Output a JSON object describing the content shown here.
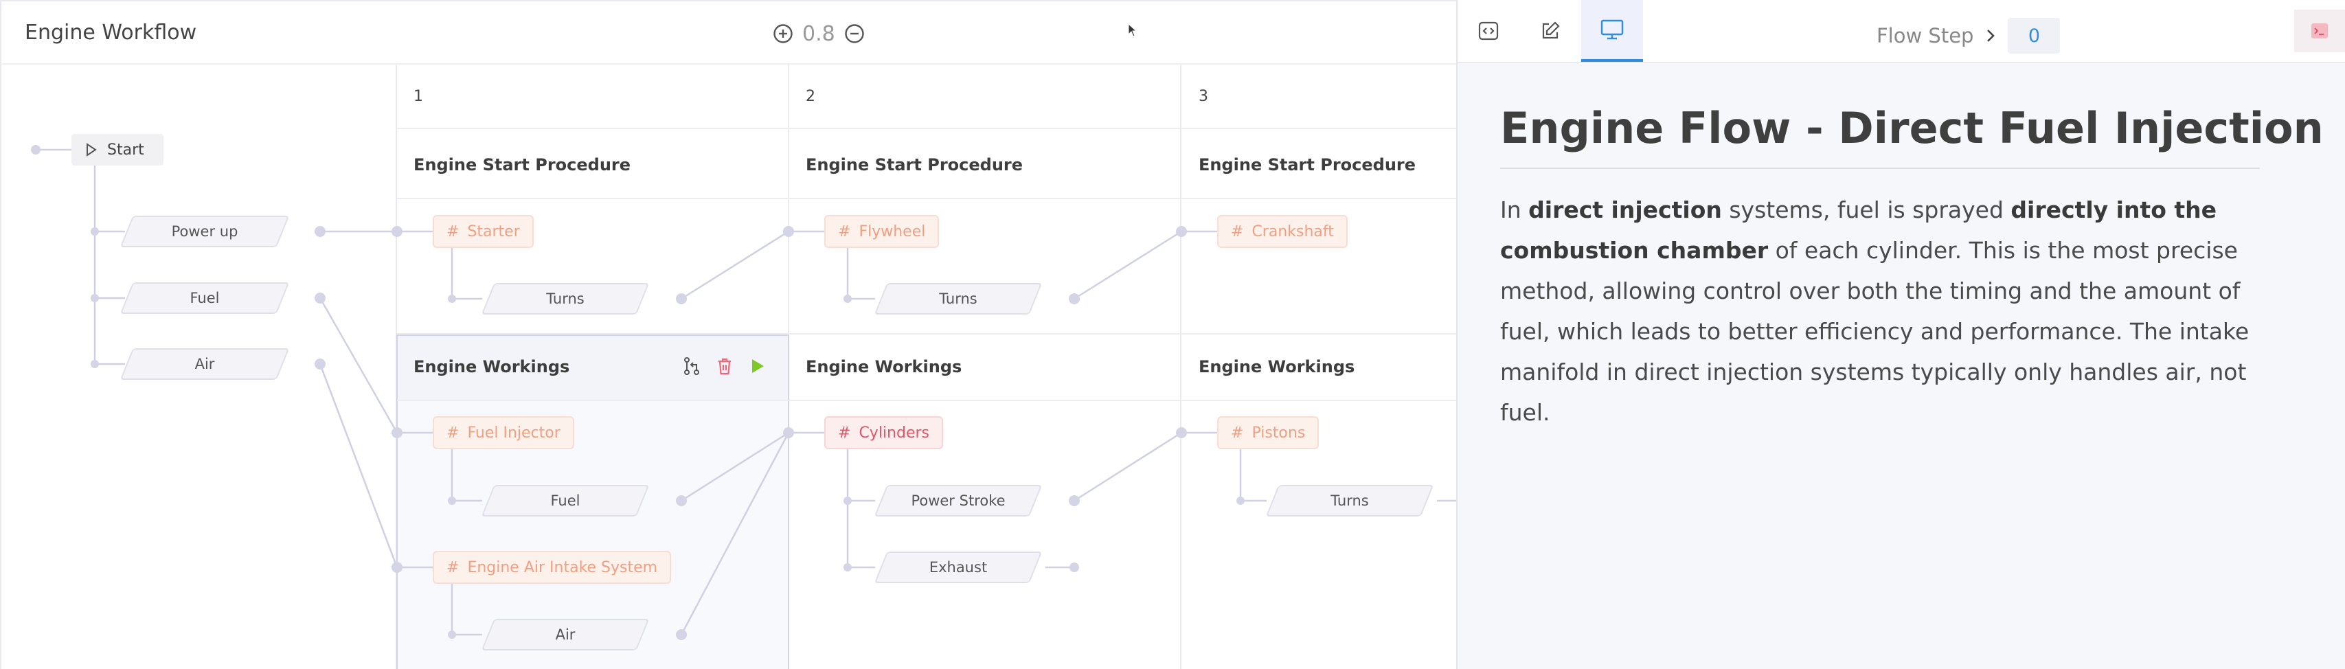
{
  "app": {
    "title": "Engine Workflow"
  },
  "zoom": {
    "value": "0.8"
  },
  "columns": [
    {
      "number": "1"
    },
    {
      "number": "2"
    },
    {
      "number": "3"
    }
  ],
  "start": {
    "label": "Start"
  },
  "inputs": [
    {
      "label": "Power up"
    },
    {
      "label": "Fuel"
    },
    {
      "label": "Air"
    }
  ],
  "sections": {
    "start_procedure": "Engine Start Procedure",
    "workings": "Engine Workings"
  },
  "steps": {
    "starter": {
      "label": "Starter",
      "output": "Turns"
    },
    "flywheel": {
      "label": "Flywheel",
      "output": "Turns"
    },
    "crankshaft": {
      "label": "Crankshaft"
    },
    "fuel_injector": {
      "label": "Fuel Injector",
      "output": "Fuel"
    },
    "air_intake": {
      "label": "Engine Air Intake System",
      "output": "Air"
    },
    "cylinders": {
      "label": "Cylinders",
      "outputs": [
        "Power Stroke",
        "Exhaust"
      ]
    },
    "pistons": {
      "label": "Pistons",
      "output": "Turns"
    }
  },
  "panel": {
    "breadcrumb": "Flow Step",
    "step_number": "0",
    "doc_title": "Engine Flow - Direct Fuel Injection",
    "doc_segments": [
      {
        "text": "In ",
        "bold": false
      },
      {
        "text": "direct injection",
        "bold": true
      },
      {
        "text": " systems, fuel is sprayed ",
        "bold": false
      },
      {
        "text": "directly into the combustion chamber",
        "bold": true
      },
      {
        "text": " of each cylinder. This is the most precise method, allowing control over both the timing and the amount of fuel, which leads to better efficiency and performance. The intake manifold in direct injection systems typically only handles air, not fuel.",
        "bold": false
      }
    ]
  },
  "colors": {
    "accent": "#2d8de0",
    "tag_orange": "#f0a082",
    "tag_red": "#e0566a",
    "play_green": "#7ec927",
    "delete_red": "#f0657a"
  },
  "icons": {
    "zoom_in": "plus-circle-icon",
    "zoom_out": "minus-circle-icon",
    "start": "play-outline-icon",
    "code_tab": "code-icon",
    "edit_tab": "pencil-icon",
    "preview_tab": "monitor-icon",
    "terminal": "terminal-icon"
  }
}
